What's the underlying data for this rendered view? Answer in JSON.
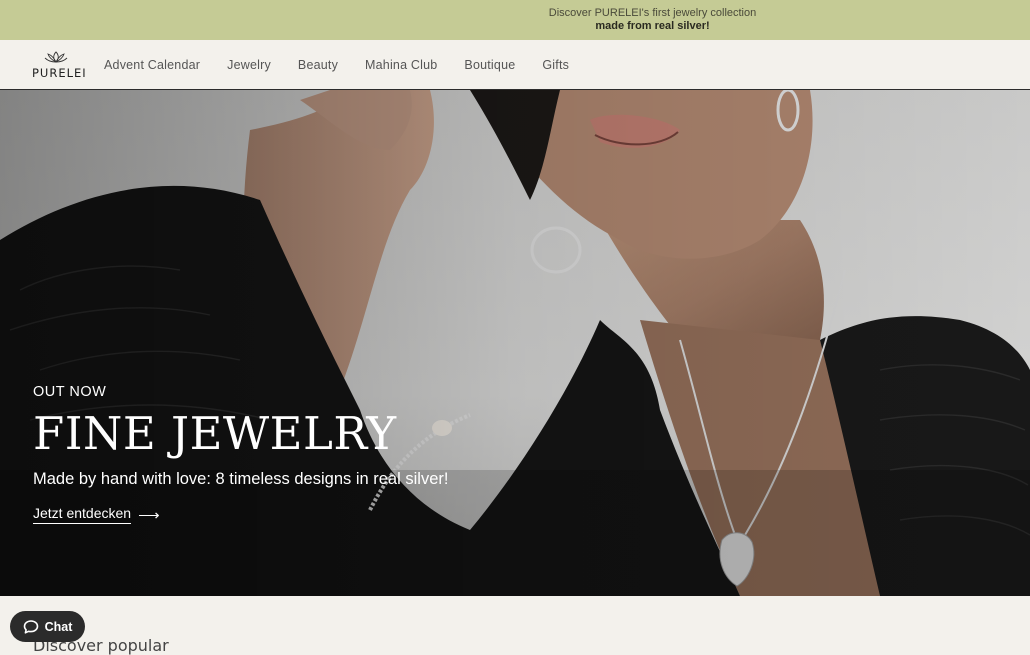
{
  "announcement": {
    "line1": "Discover PURELEI's first jewelry collection",
    "line2": "made from real silver!"
  },
  "brand": {
    "name": "PURELEI"
  },
  "nav": {
    "items": [
      {
        "label": "Advent Calendar"
      },
      {
        "label": "Jewelry"
      },
      {
        "label": "Beauty"
      },
      {
        "label": "Mahina Club"
      },
      {
        "label": "Boutique"
      },
      {
        "label": "Gifts"
      }
    ]
  },
  "hero": {
    "eyebrow": "OUT NOW",
    "headline": "FINE JEWELRY",
    "subtitle": "Made by hand with love: 8 timeless designs in real silver!",
    "cta_label": "Jetzt entdecken",
    "cta_arrow": "⟶"
  },
  "section": {
    "heading": "Discover popular"
  },
  "chat": {
    "label": "Chat",
    "icon": "chat-bubble-icon"
  },
  "colors": {
    "announcement_bg": "#c5cb95",
    "page_bg": "#f3f1ec",
    "chat_bg": "#2b2b2b"
  }
}
